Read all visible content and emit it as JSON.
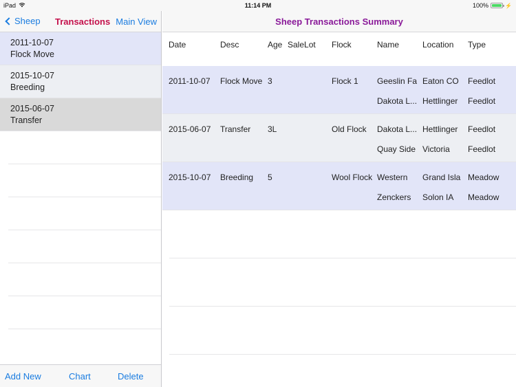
{
  "status_bar": {
    "device": "iPad",
    "time": "11:14 PM",
    "battery": "100%",
    "battery_level": 1.0
  },
  "left_nav": {
    "back_label": "Sheep",
    "title": "Transactions",
    "right_button": "Main View"
  },
  "list": {
    "items": [
      {
        "date": "2011-10-07",
        "desc": "Flock Move"
      },
      {
        "date": "2015-10-07",
        "desc": "Breeding"
      },
      {
        "date": "2015-06-07",
        "desc": "Transfer"
      }
    ]
  },
  "toolbar": {
    "add_new": "Add New",
    "chart": "Chart",
    "delete": "Delete"
  },
  "right_nav": {
    "title": "Sheep Transactions Summary"
  },
  "table": {
    "headers": {
      "date": "Date",
      "desc": "Desc",
      "age": "Age",
      "salelot": "SaleLot",
      "flock": "Flock",
      "name": "Name",
      "location": "Location",
      "type": "Type"
    },
    "rows": [
      {
        "date": "2011-10-07",
        "desc": "Flock Move",
        "age": "3",
        "salelot": "",
        "flock": "Flock 1",
        "lines": [
          {
            "name": "Geeslin Fa",
            "location": "Eaton CO",
            "type": "Feedlot"
          },
          {
            "name": "Dakota L...",
            "location": "Hettlinger",
            "type": "Feedlot"
          }
        ]
      },
      {
        "date": "2015-06-07",
        "desc": "Transfer",
        "age": "3L",
        "salelot": "",
        "flock": "Old Flock",
        "lines": [
          {
            "name": "Dakota L...",
            "location": "Hettlinger",
            "type": "Feedlot"
          },
          {
            "name": "Quay Side",
            "location": "Victoria",
            "type": "Feedlot"
          }
        ]
      },
      {
        "date": "2015-10-07",
        "desc": "Breeding",
        "age": "5",
        "salelot": "",
        "flock": "Wool Flock",
        "lines": [
          {
            "name": "Western",
            "location": "Grand Isla",
            "type": "Meadow"
          },
          {
            "name": "Zenckers",
            "location": "Solon IA",
            "type": "Meadow"
          }
        ]
      }
    ]
  }
}
